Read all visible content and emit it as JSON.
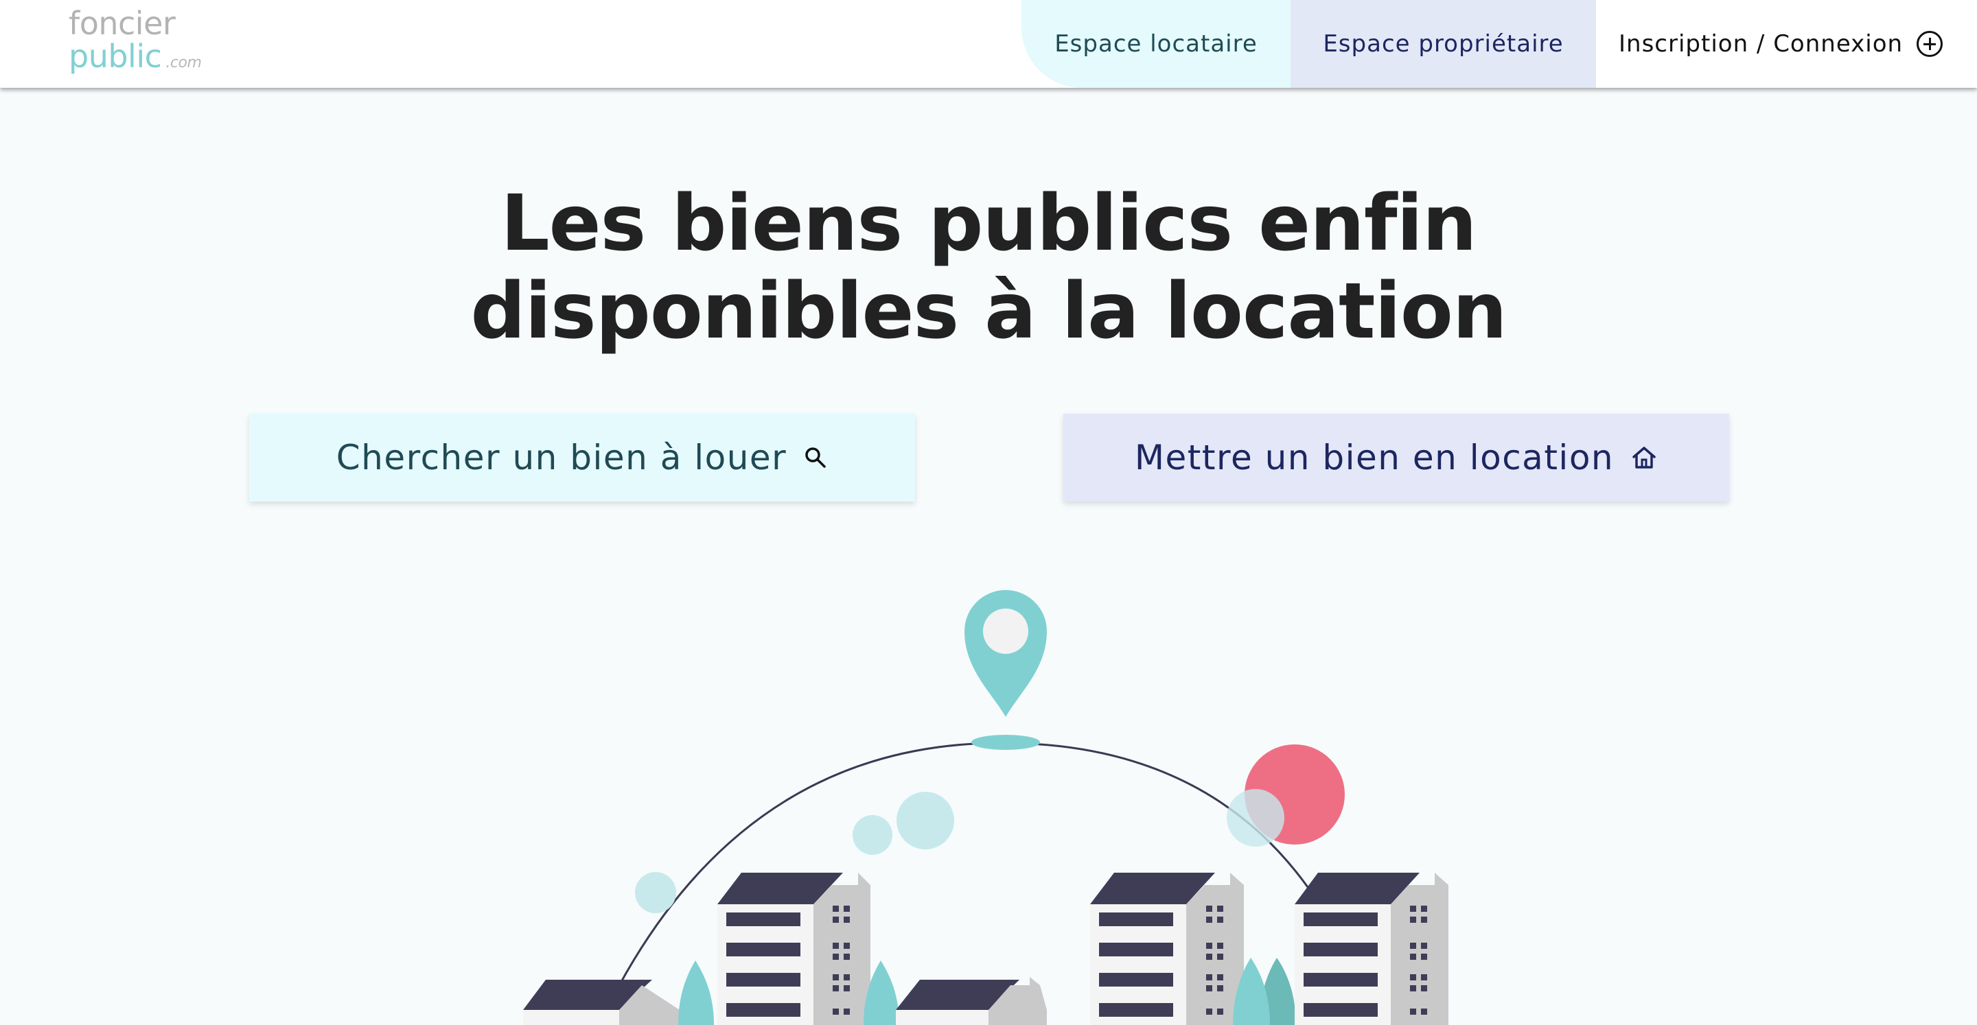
{
  "logo": {
    "line1": "foncier",
    "line2": "public",
    "suffix": ".com"
  },
  "nav": {
    "tenant": "Espace locataire",
    "owner": "Espace propriétaire",
    "login": "Inscription / Connexion",
    "login_icon": "plus-circle-icon"
  },
  "hero": {
    "title_line1": "Les biens publics enfin",
    "title_line2": "disponibles à la location"
  },
  "actions": {
    "search_label": "Chercher un bien à louer",
    "search_icon": "search-icon",
    "rent_label": "Mettre un bien en location",
    "rent_icon": "house-icon"
  },
  "colors": {
    "accent_teal": "#80d0d2",
    "tenant_bg": "#e4fafc",
    "owner_bg": "#e3e8f7",
    "owner_text": "#1c2660",
    "pink": "#ee6f84",
    "building_dark": "#3f3d56"
  }
}
